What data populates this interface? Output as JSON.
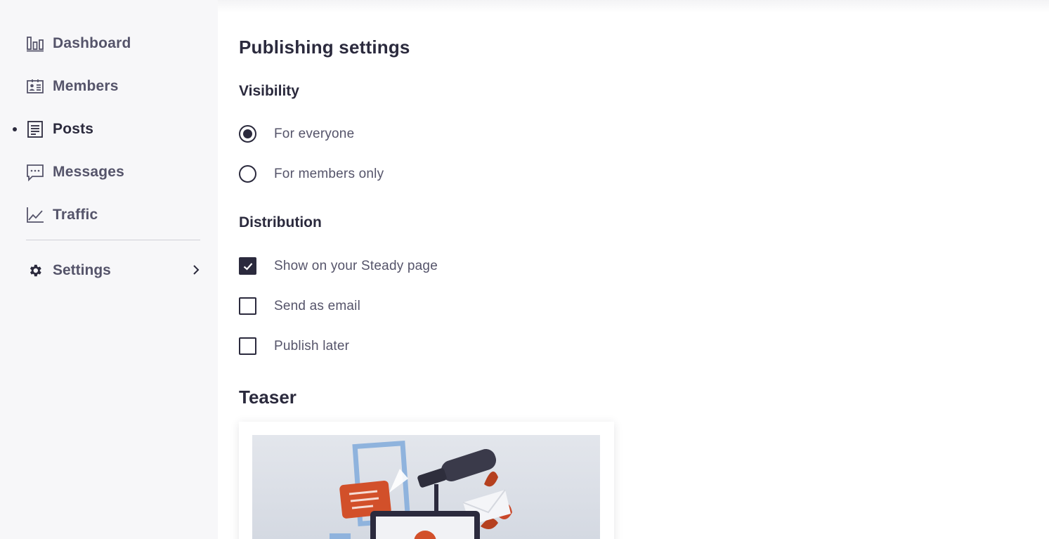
{
  "sidebar": {
    "items": [
      {
        "label": "Dashboard",
        "icon": "bar-chart-icon",
        "active": false
      },
      {
        "label": "Members",
        "icon": "id-card-icon",
        "active": false
      },
      {
        "label": "Posts",
        "icon": "document-icon",
        "active": true
      },
      {
        "label": "Messages",
        "icon": "chat-bubble-icon",
        "active": false
      },
      {
        "label": "Traffic",
        "icon": "line-chart-icon",
        "active": false
      }
    ],
    "settings": {
      "label": "Settings",
      "icon": "gear-icon",
      "chevron": "chevron-right-icon"
    }
  },
  "main": {
    "title": "Publishing settings",
    "visibility": {
      "heading": "Visibility",
      "options": [
        {
          "label": "For everyone",
          "checked": true
        },
        {
          "label": "For members only",
          "checked": false
        }
      ]
    },
    "distribution": {
      "heading": "Distribution",
      "options": [
        {
          "label": "Show on your Steady page",
          "checked": true
        },
        {
          "label": "Send as email",
          "checked": false
        },
        {
          "label": "Publish later",
          "checked": false
        }
      ]
    },
    "teaser": {
      "heading": "Teaser",
      "image": "teaser-illustration"
    }
  },
  "colors": {
    "text_dark": "#2b2a3d",
    "text_muted": "#55546a",
    "sidebar_bg": "#f7f7f9",
    "accent_orange": "#d2502a"
  }
}
